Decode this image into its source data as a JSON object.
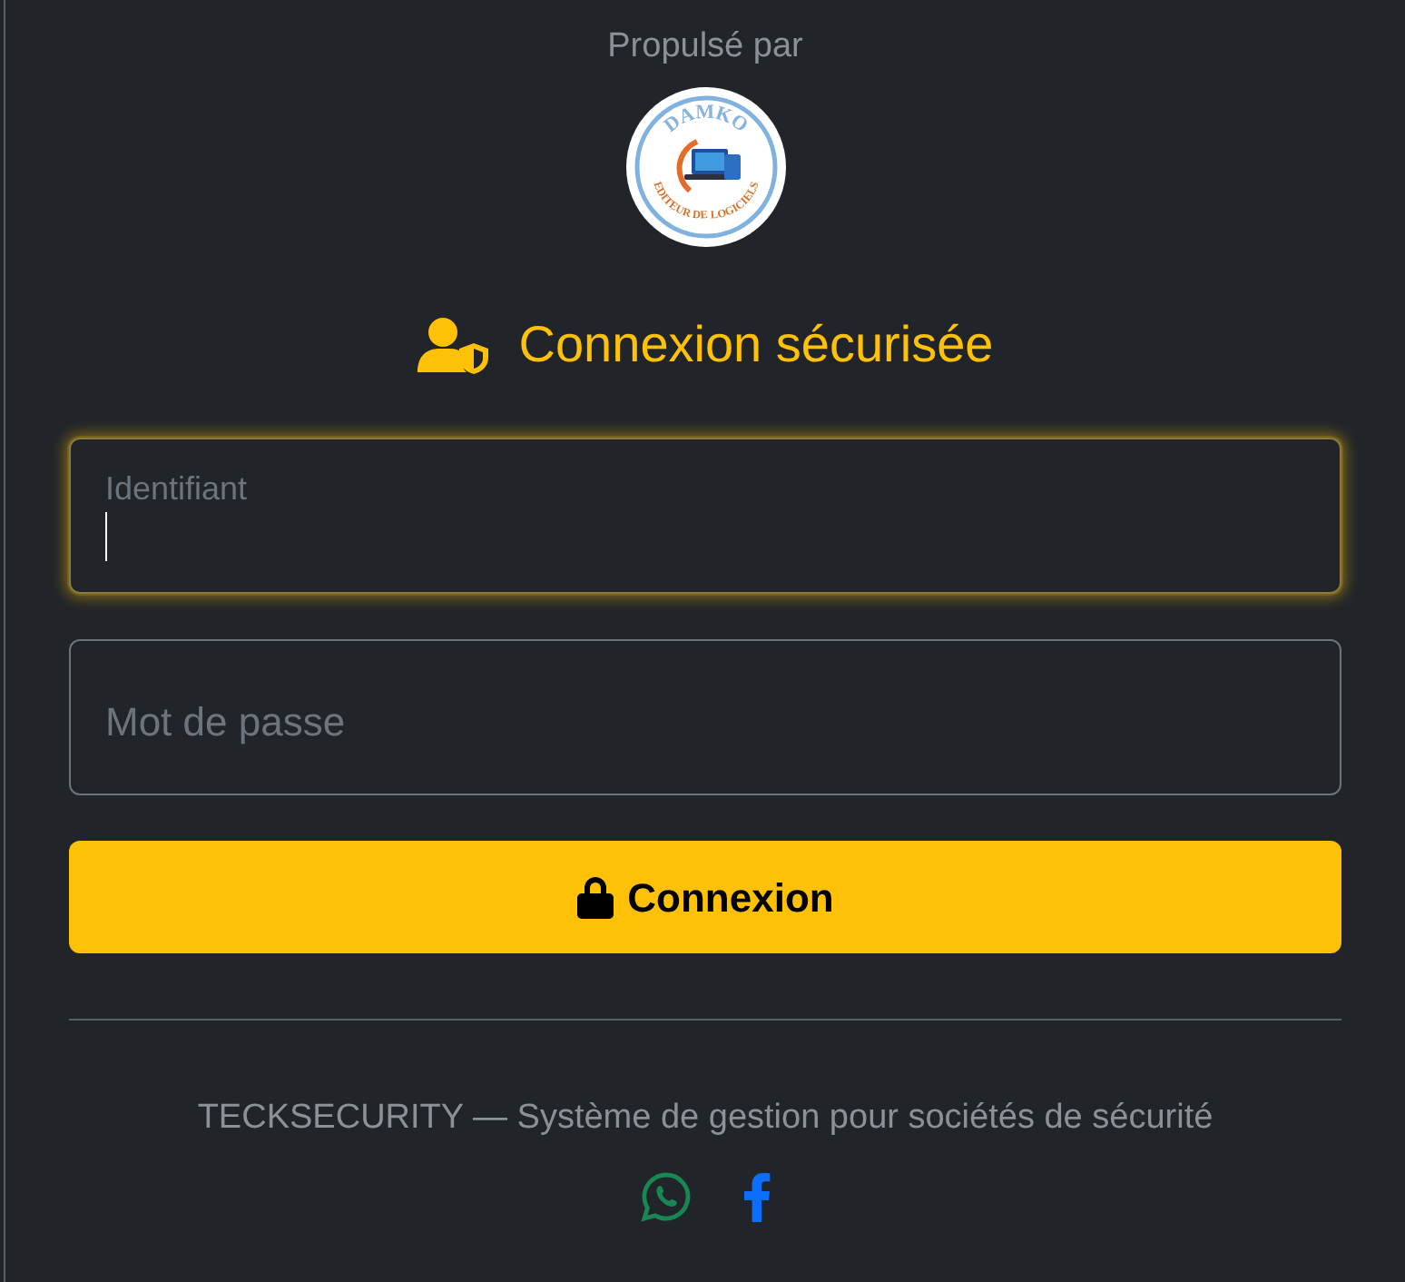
{
  "powered_by": "Propulsé par",
  "logo": {
    "title": "DAMKO",
    "subtitle": "EDITEUR DE LOGICIELS"
  },
  "heading": "Connexion sécurisée",
  "fields": [
    {
      "label": "Identifiant",
      "focused": true
    },
    {
      "label": "Mot de passe",
      "focused": false
    }
  ],
  "submit_button": "Connexion",
  "footer": "TECKSECURITY — Système de gestion pour sociétés de sécurité"
}
